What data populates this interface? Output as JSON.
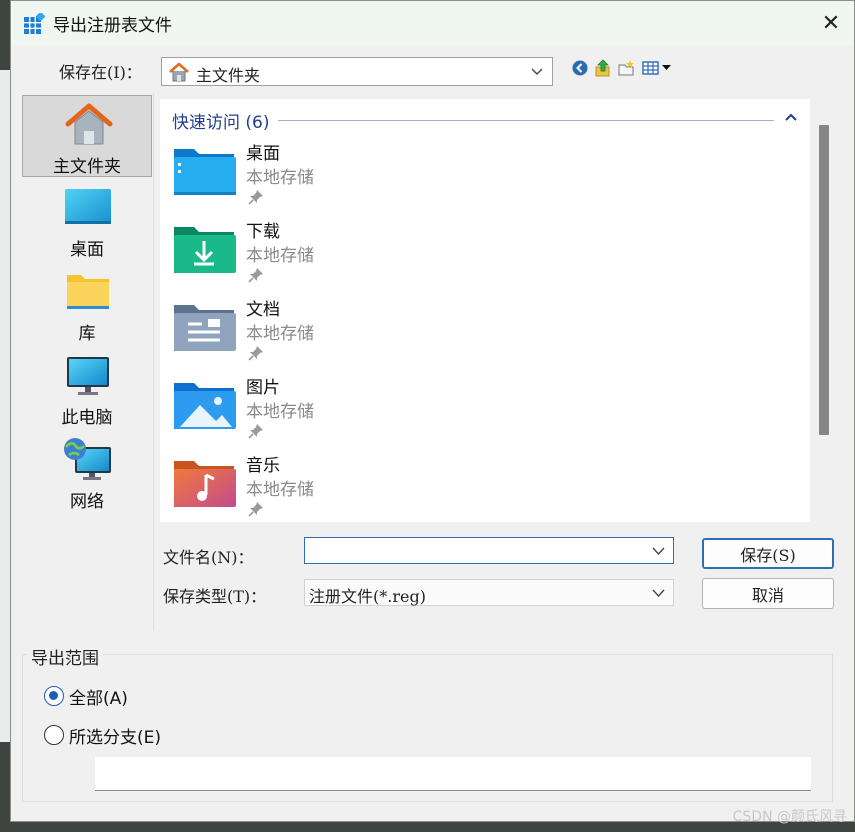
{
  "window": {
    "title": "导出注册表文件",
    "close_glyph": "✕"
  },
  "toolbar": {
    "save_in_label": "保存在(I)：",
    "save_in_value": "主文件夹",
    "icons": [
      "back-icon",
      "up-folder-icon",
      "new-folder-icon",
      "view-menu-icon"
    ]
  },
  "places": [
    {
      "label": "主文件夹",
      "icon": "home-icon",
      "selected": true
    },
    {
      "label": "桌面",
      "icon": "desktop-icon"
    },
    {
      "label": "库",
      "icon": "library-icon"
    },
    {
      "label": "此电脑",
      "icon": "computer-icon"
    },
    {
      "label": "网络",
      "icon": "network-icon"
    }
  ],
  "file_list": {
    "group_title": "快速访问 (6)",
    "items": [
      {
        "name": "桌面",
        "sub": "本地存储",
        "icon": "desktop-folder-icon"
      },
      {
        "name": "下载",
        "sub": "本地存储",
        "icon": "downloads-folder-icon"
      },
      {
        "name": "文档",
        "sub": "本地存储",
        "icon": "documents-folder-icon"
      },
      {
        "name": "图片",
        "sub": "本地存储",
        "icon": "pictures-folder-icon"
      },
      {
        "name": "音乐",
        "sub": "本地存储",
        "icon": "music-folder-icon"
      }
    ]
  },
  "form": {
    "filename_label": "文件名(N)：",
    "filename_value": "",
    "filetype_label": "保存类型(T)：",
    "filetype_value": "注册文件(*.reg)",
    "save_button": "保存(S)",
    "cancel_button": "取消"
  },
  "export_range": {
    "title": "导出范围",
    "options": [
      {
        "label": "全部(A)",
        "checked": true
      },
      {
        "label": "所选分支(E)",
        "checked": false
      }
    ],
    "branch_value": ""
  },
  "watermark": "CSDN @颜氏风寻"
}
